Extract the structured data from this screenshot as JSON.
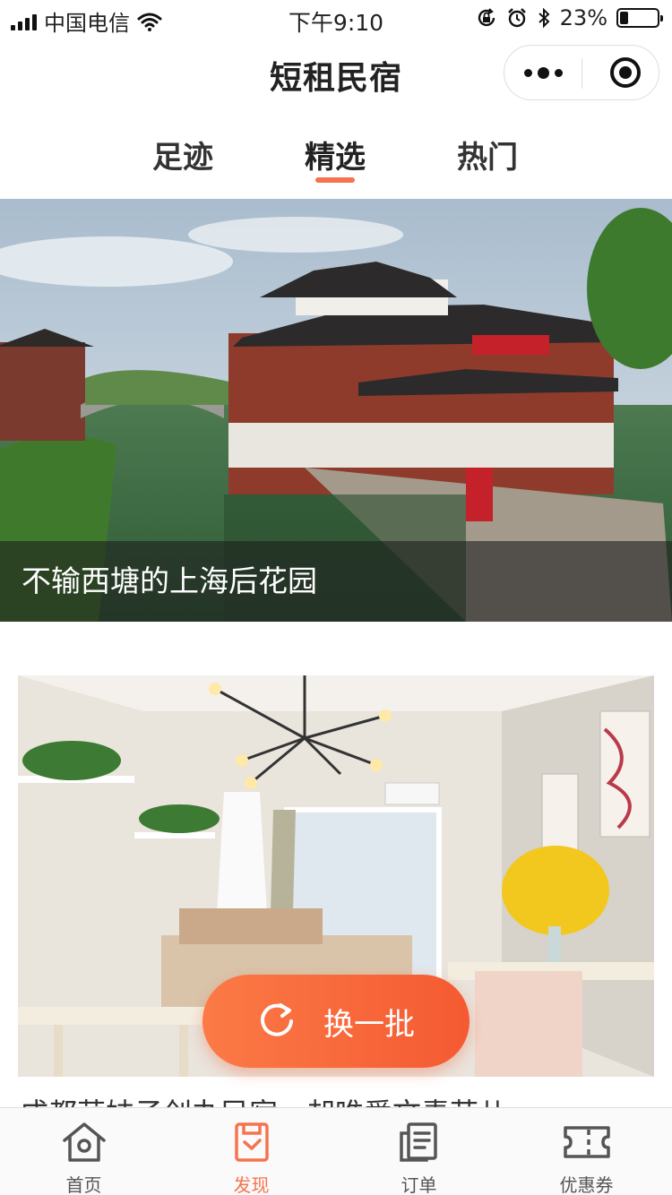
{
  "status_bar": {
    "carrier": "中国电信",
    "time": "下午9:10",
    "battery_text": "23%",
    "battery_level": 0.23
  },
  "nav": {
    "title": "短租民宿"
  },
  "tabs": [
    {
      "label": "足迹",
      "active": false
    },
    {
      "label": "精选",
      "active": true
    },
    {
      "label": "热门",
      "active": false
    }
  ],
  "cards": [
    {
      "caption": "不输西塘的上海后花园"
    },
    {
      "caption": "成都萌妹子创办民宿，却唯爱文青范儿"
    }
  ],
  "refresh_button": {
    "label": "换一批"
  },
  "tab_bar": [
    {
      "label": "首页",
      "icon": "home-icon",
      "active": false
    },
    {
      "label": "发现",
      "icon": "discover-icon",
      "active": true
    },
    {
      "label": "订单",
      "icon": "orders-icon",
      "active": false
    },
    {
      "label": "优惠券",
      "icon": "coupon-icon",
      "active": false
    }
  ],
  "colors": {
    "accent": "#f5744f",
    "button_gradient_start": "#fb7a46",
    "button_gradient_end": "#f55a32"
  }
}
